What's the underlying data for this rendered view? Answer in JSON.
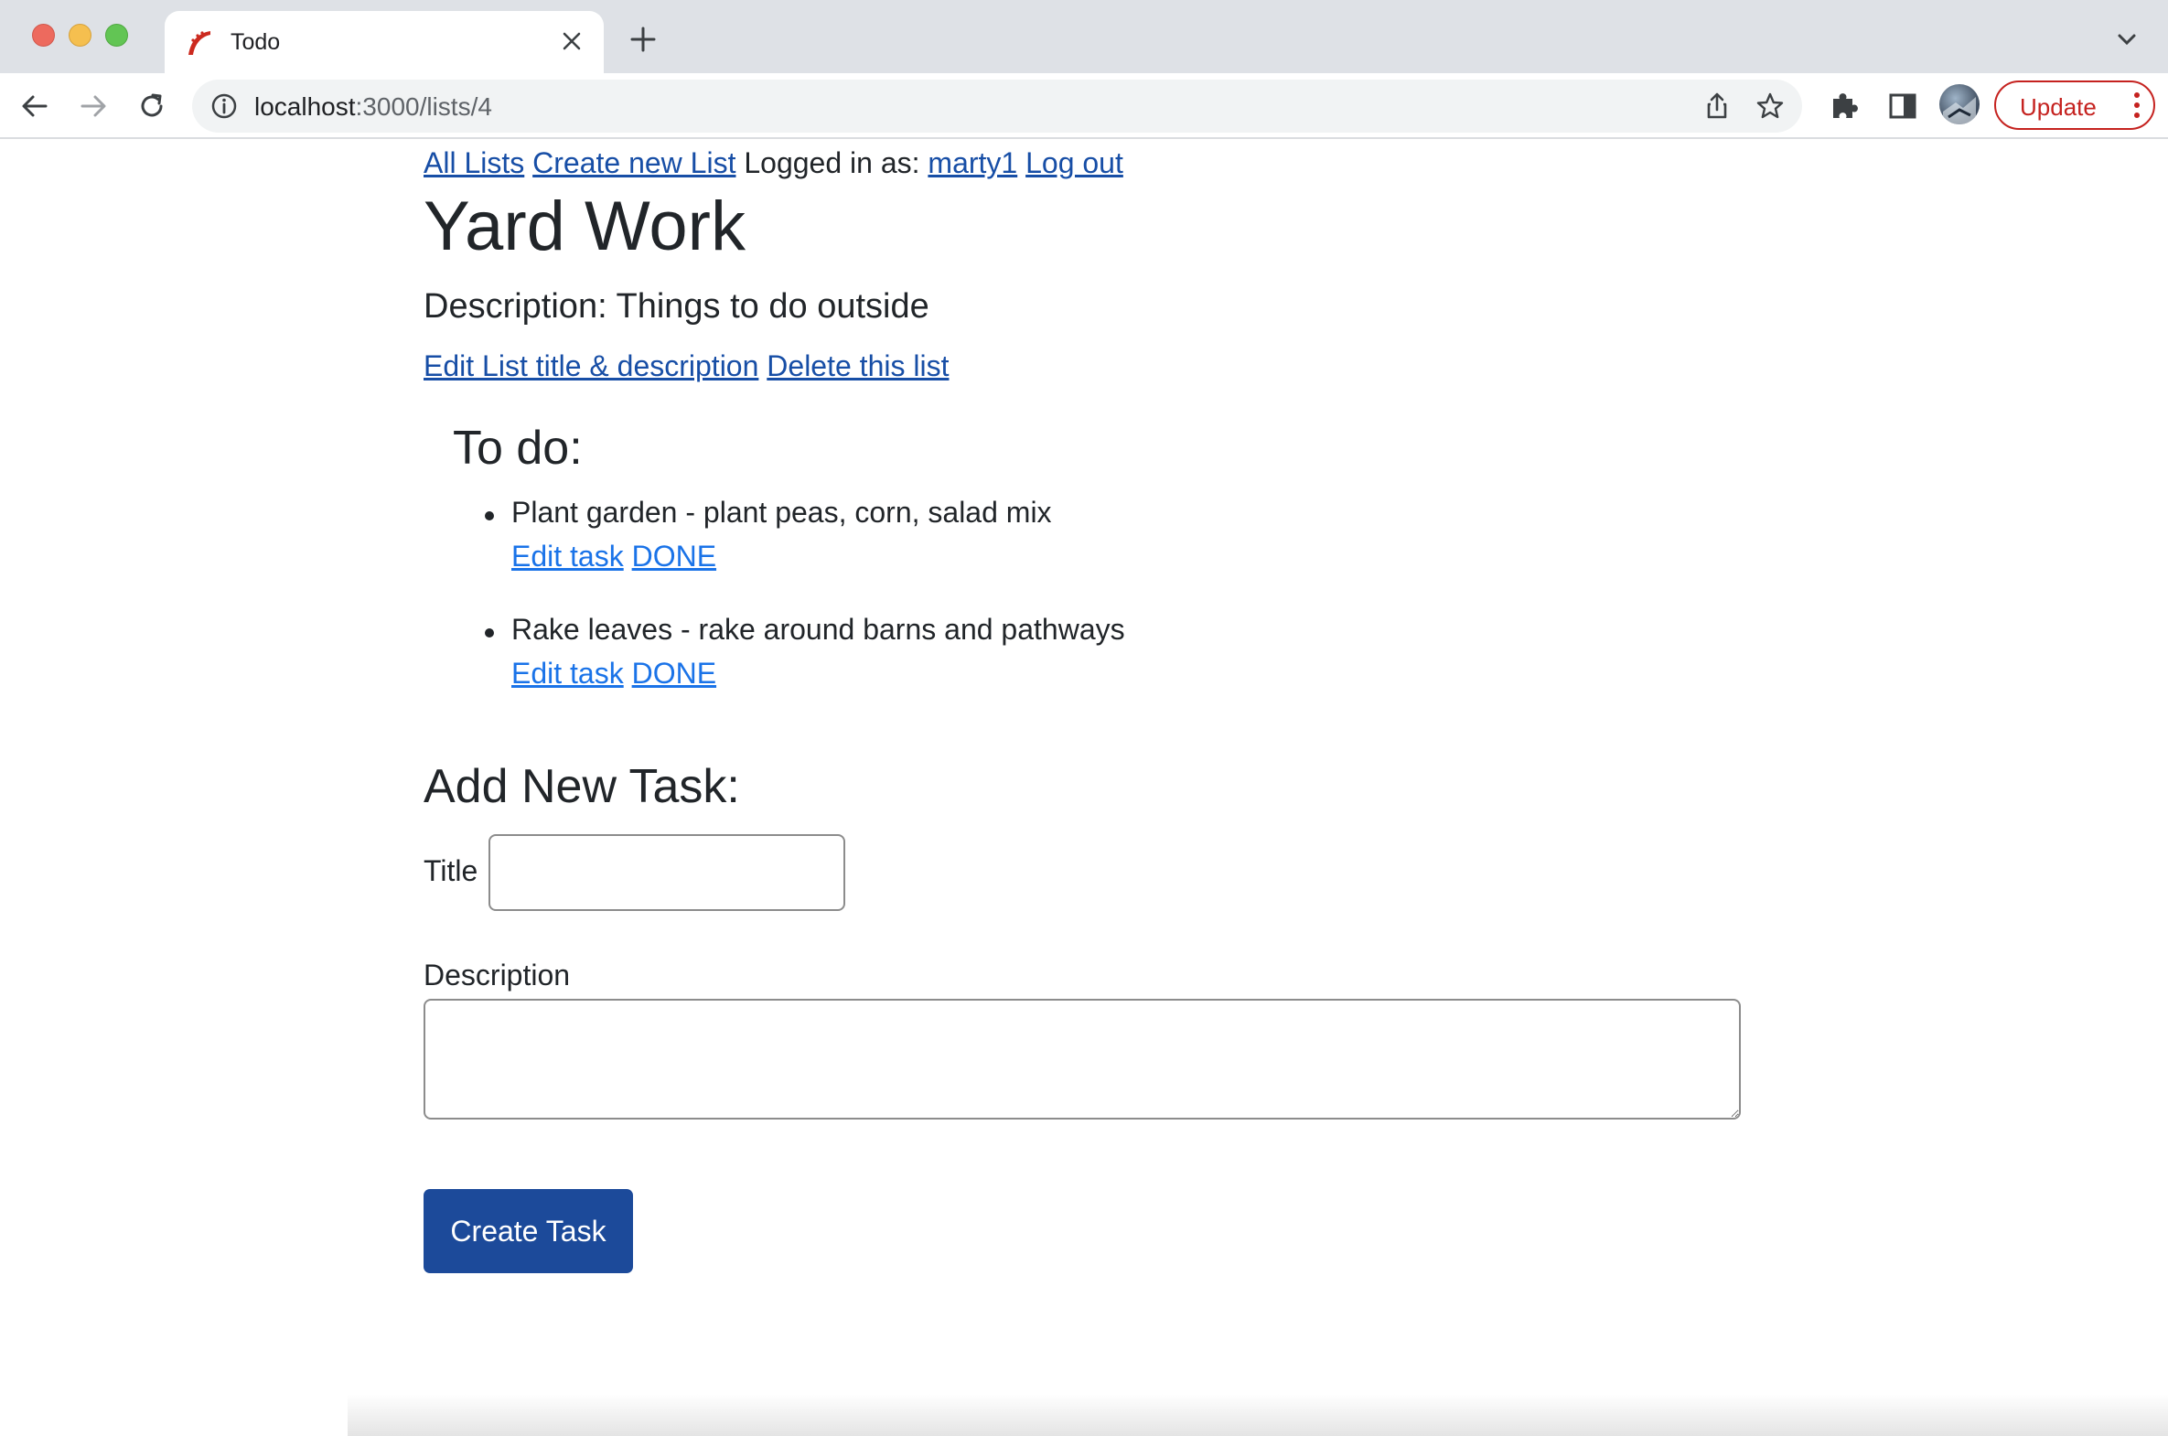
{
  "browser": {
    "tab_title": "Todo",
    "url_host": "localhost",
    "url_rest": ":3000/lists/4",
    "update_label": "Update"
  },
  "nav": {
    "all_lists": "All Lists",
    "create_list": "Create new List",
    "logged_in_prefix": "Logged in as:",
    "username": "marty1",
    "logout": "Log out"
  },
  "list": {
    "title": "Yard Work",
    "description": "Description: Things to do outside",
    "edit_link": "Edit List title & description",
    "delete_link": "Delete this list"
  },
  "todo": {
    "heading": "To do:",
    "tasks": [
      {
        "text": "Plant garden - plant peas, corn, salad mix",
        "edit": "Edit task",
        "done": "DONE"
      },
      {
        "text": "Rake leaves - rake around barns and pathways",
        "edit": "Edit task",
        "done": "DONE"
      }
    ]
  },
  "form": {
    "heading": "Add New Task:",
    "title_label": "Title",
    "title_value": "",
    "description_label": "Description",
    "description_value": "",
    "submit_label": "Create Task"
  },
  "colors": {
    "link": "#174ea6",
    "task_link": "#1a73e8",
    "button_bg": "#1c4a9a",
    "update_red": "#c5221f"
  },
  "icons": [
    "back-arrow-icon",
    "forward-arrow-icon",
    "reload-icon",
    "info-icon",
    "share-icon",
    "star-icon",
    "puzzle-icon",
    "side-panel-icon",
    "kebab-menu-icon",
    "close-icon",
    "plus-icon",
    "chevron-down-icon",
    "rails-favicon"
  ]
}
